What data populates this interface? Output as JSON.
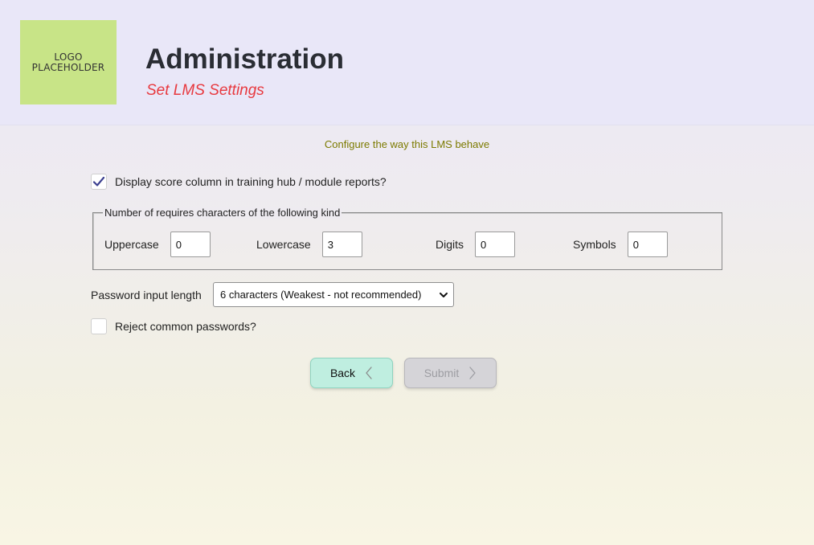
{
  "header": {
    "logo_line1": "LOGO",
    "logo_line2": "PLACEHOLDER",
    "title": "Administration",
    "subtitle": "Set LMS Settings"
  },
  "intro": "Configure the way this LMS behave",
  "score_column": {
    "label": "Display score column in training hub / module reports?",
    "checked": true
  },
  "password_requirements": {
    "legend": "Number of requires characters of the following kind",
    "fields": [
      {
        "label": "Uppercase",
        "value": "0"
      },
      {
        "label": "Lowercase",
        "value": "3"
      },
      {
        "label": "Digits",
        "value": "0"
      },
      {
        "label": "Symbols",
        "value": "0"
      }
    ]
  },
  "password_length": {
    "label": "Password input length",
    "selected": "6 characters (Weakest - not recommended)"
  },
  "reject_common": {
    "label": "Reject common passwords?",
    "checked": false
  },
  "buttons": {
    "back": "Back",
    "submit": "Submit"
  },
  "colors": {
    "accent_red": "#e8393f",
    "intro_text": "#7c7a00",
    "logo_bg": "#c8e487",
    "back_button": "#bfeee0",
    "submit_disabled": "#d5d4d8"
  }
}
